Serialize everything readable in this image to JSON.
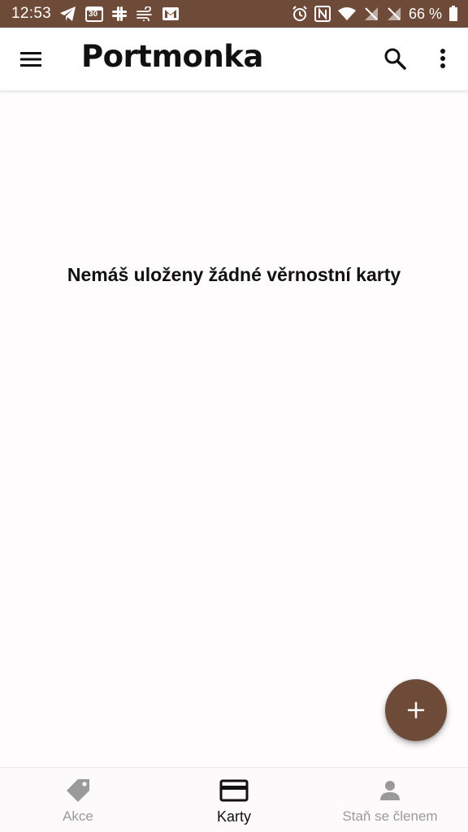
{
  "status_bar": {
    "time": "12:53",
    "calendar_day": "30",
    "battery": "66 %",
    "icons_left": [
      "telegram-icon",
      "calendar-icon",
      "slack-icon",
      "wind-icon",
      "gmail-icon"
    ],
    "icons_right": [
      "alarm-icon",
      "nfc-icon",
      "wifi-icon",
      "signal-off-icon",
      "signal-off-icon",
      "battery-icon"
    ]
  },
  "app_bar": {
    "title": "Portmonka",
    "menu_icon": "menu-icon",
    "search_icon": "search-icon",
    "more_icon": "more-vertical-icon"
  },
  "main": {
    "empty_message": "Nemáš uloženy žádné věrnostní karty"
  },
  "fab": {
    "icon": "plus-icon"
  },
  "bottom_nav": {
    "items": [
      {
        "label": "Akce",
        "icon": "tag-icon",
        "active": false
      },
      {
        "label": "Karty",
        "icon": "card-icon",
        "active": true
      },
      {
        "label": "Staň se členem",
        "icon": "person-icon",
        "active": false
      }
    ]
  },
  "colors": {
    "brand": "#6e4a38",
    "inactive": "#9a9a9a",
    "text": "#111111"
  }
}
